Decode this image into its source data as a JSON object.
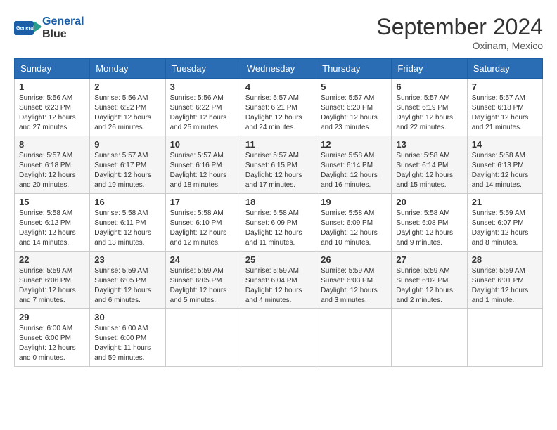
{
  "header": {
    "logo_line1": "General",
    "logo_line2": "Blue",
    "month": "September 2024",
    "location": "Oxinam, Mexico"
  },
  "weekdays": [
    "Sunday",
    "Monday",
    "Tuesday",
    "Wednesday",
    "Thursday",
    "Friday",
    "Saturday"
  ],
  "weeks": [
    [
      {
        "day": "1",
        "info": "Sunrise: 5:56 AM\nSunset: 6:23 PM\nDaylight: 12 hours\nand 27 minutes."
      },
      {
        "day": "2",
        "info": "Sunrise: 5:56 AM\nSunset: 6:22 PM\nDaylight: 12 hours\nand 26 minutes."
      },
      {
        "day": "3",
        "info": "Sunrise: 5:56 AM\nSunset: 6:22 PM\nDaylight: 12 hours\nand 25 minutes."
      },
      {
        "day": "4",
        "info": "Sunrise: 5:57 AM\nSunset: 6:21 PM\nDaylight: 12 hours\nand 24 minutes."
      },
      {
        "day": "5",
        "info": "Sunrise: 5:57 AM\nSunset: 6:20 PM\nDaylight: 12 hours\nand 23 minutes."
      },
      {
        "day": "6",
        "info": "Sunrise: 5:57 AM\nSunset: 6:19 PM\nDaylight: 12 hours\nand 22 minutes."
      },
      {
        "day": "7",
        "info": "Sunrise: 5:57 AM\nSunset: 6:18 PM\nDaylight: 12 hours\nand 21 minutes."
      }
    ],
    [
      {
        "day": "8",
        "info": "Sunrise: 5:57 AM\nSunset: 6:18 PM\nDaylight: 12 hours\nand 20 minutes."
      },
      {
        "day": "9",
        "info": "Sunrise: 5:57 AM\nSunset: 6:17 PM\nDaylight: 12 hours\nand 19 minutes."
      },
      {
        "day": "10",
        "info": "Sunrise: 5:57 AM\nSunset: 6:16 PM\nDaylight: 12 hours\nand 18 minutes."
      },
      {
        "day": "11",
        "info": "Sunrise: 5:57 AM\nSunset: 6:15 PM\nDaylight: 12 hours\nand 17 minutes."
      },
      {
        "day": "12",
        "info": "Sunrise: 5:58 AM\nSunset: 6:14 PM\nDaylight: 12 hours\nand 16 minutes."
      },
      {
        "day": "13",
        "info": "Sunrise: 5:58 AM\nSunset: 6:14 PM\nDaylight: 12 hours\nand 15 minutes."
      },
      {
        "day": "14",
        "info": "Sunrise: 5:58 AM\nSunset: 6:13 PM\nDaylight: 12 hours\nand 14 minutes."
      }
    ],
    [
      {
        "day": "15",
        "info": "Sunrise: 5:58 AM\nSunset: 6:12 PM\nDaylight: 12 hours\nand 14 minutes."
      },
      {
        "day": "16",
        "info": "Sunrise: 5:58 AM\nSunset: 6:11 PM\nDaylight: 12 hours\nand 13 minutes."
      },
      {
        "day": "17",
        "info": "Sunrise: 5:58 AM\nSunset: 6:10 PM\nDaylight: 12 hours\nand 12 minutes."
      },
      {
        "day": "18",
        "info": "Sunrise: 5:58 AM\nSunset: 6:09 PM\nDaylight: 12 hours\nand 11 minutes."
      },
      {
        "day": "19",
        "info": "Sunrise: 5:58 AM\nSunset: 6:09 PM\nDaylight: 12 hours\nand 10 minutes."
      },
      {
        "day": "20",
        "info": "Sunrise: 5:58 AM\nSunset: 6:08 PM\nDaylight: 12 hours\nand 9 minutes."
      },
      {
        "day": "21",
        "info": "Sunrise: 5:59 AM\nSunset: 6:07 PM\nDaylight: 12 hours\nand 8 minutes."
      }
    ],
    [
      {
        "day": "22",
        "info": "Sunrise: 5:59 AM\nSunset: 6:06 PM\nDaylight: 12 hours\nand 7 minutes."
      },
      {
        "day": "23",
        "info": "Sunrise: 5:59 AM\nSunset: 6:05 PM\nDaylight: 12 hours\nand 6 minutes."
      },
      {
        "day": "24",
        "info": "Sunrise: 5:59 AM\nSunset: 6:05 PM\nDaylight: 12 hours\nand 5 minutes."
      },
      {
        "day": "25",
        "info": "Sunrise: 5:59 AM\nSunset: 6:04 PM\nDaylight: 12 hours\nand 4 minutes."
      },
      {
        "day": "26",
        "info": "Sunrise: 5:59 AM\nSunset: 6:03 PM\nDaylight: 12 hours\nand 3 minutes."
      },
      {
        "day": "27",
        "info": "Sunrise: 5:59 AM\nSunset: 6:02 PM\nDaylight: 12 hours\nand 2 minutes."
      },
      {
        "day": "28",
        "info": "Sunrise: 5:59 AM\nSunset: 6:01 PM\nDaylight: 12 hours\nand 1 minute."
      }
    ],
    [
      {
        "day": "29",
        "info": "Sunrise: 6:00 AM\nSunset: 6:00 PM\nDaylight: 12 hours\nand 0 minutes."
      },
      {
        "day": "30",
        "info": "Sunrise: 6:00 AM\nSunset: 6:00 PM\nDaylight: 11 hours\nand 59 minutes."
      },
      null,
      null,
      null,
      null,
      null
    ]
  ]
}
